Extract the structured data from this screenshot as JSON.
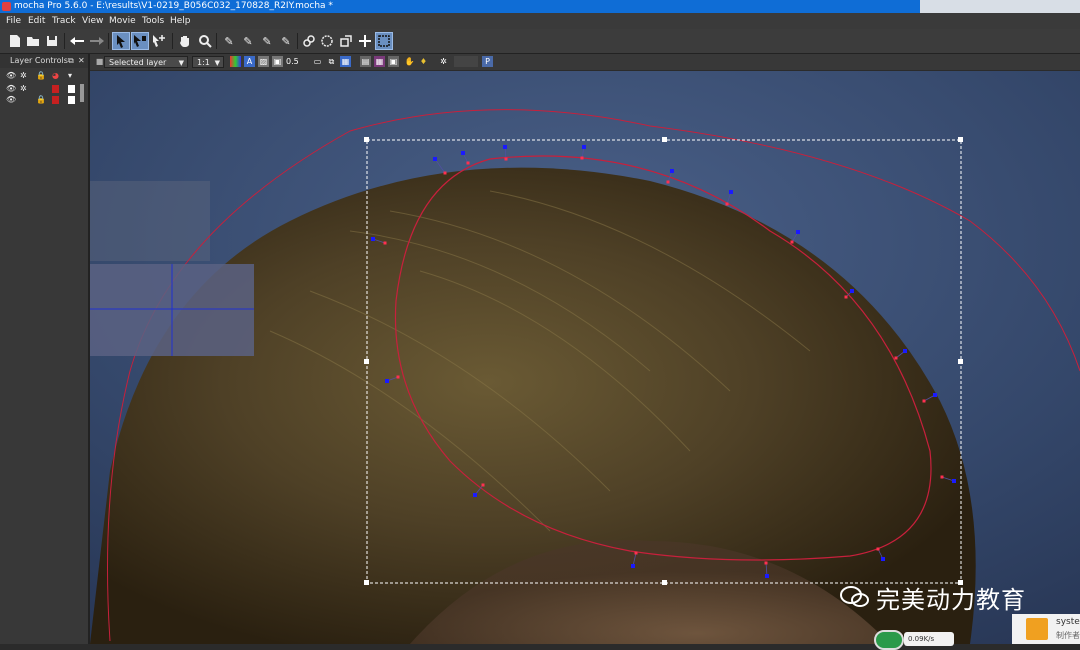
{
  "window": {
    "title": "mocha Pro 5.6.0 - E:\\results\\V1-0219_B056C032_170828_R2IY.mocha *"
  },
  "menu": [
    "File",
    "Edit",
    "Track",
    "View",
    "Movie",
    "Tools",
    "Help"
  ],
  "layer_panel": {
    "title": "Layer Controls"
  },
  "viewbar": {
    "layer_select": "Selected layer",
    "zoom_select": "1:1",
    "opacity": "0.5"
  },
  "watermark": {
    "text": "完美动力教育"
  },
  "notification": {
    "title": "syster",
    "subtitle": "制作者"
  },
  "netmon": {
    "speed": "0.09K/s"
  },
  "colors": {
    "spline": "#c8203c",
    "control_point": "#1a1aff",
    "selection_box": "#ffffff"
  }
}
